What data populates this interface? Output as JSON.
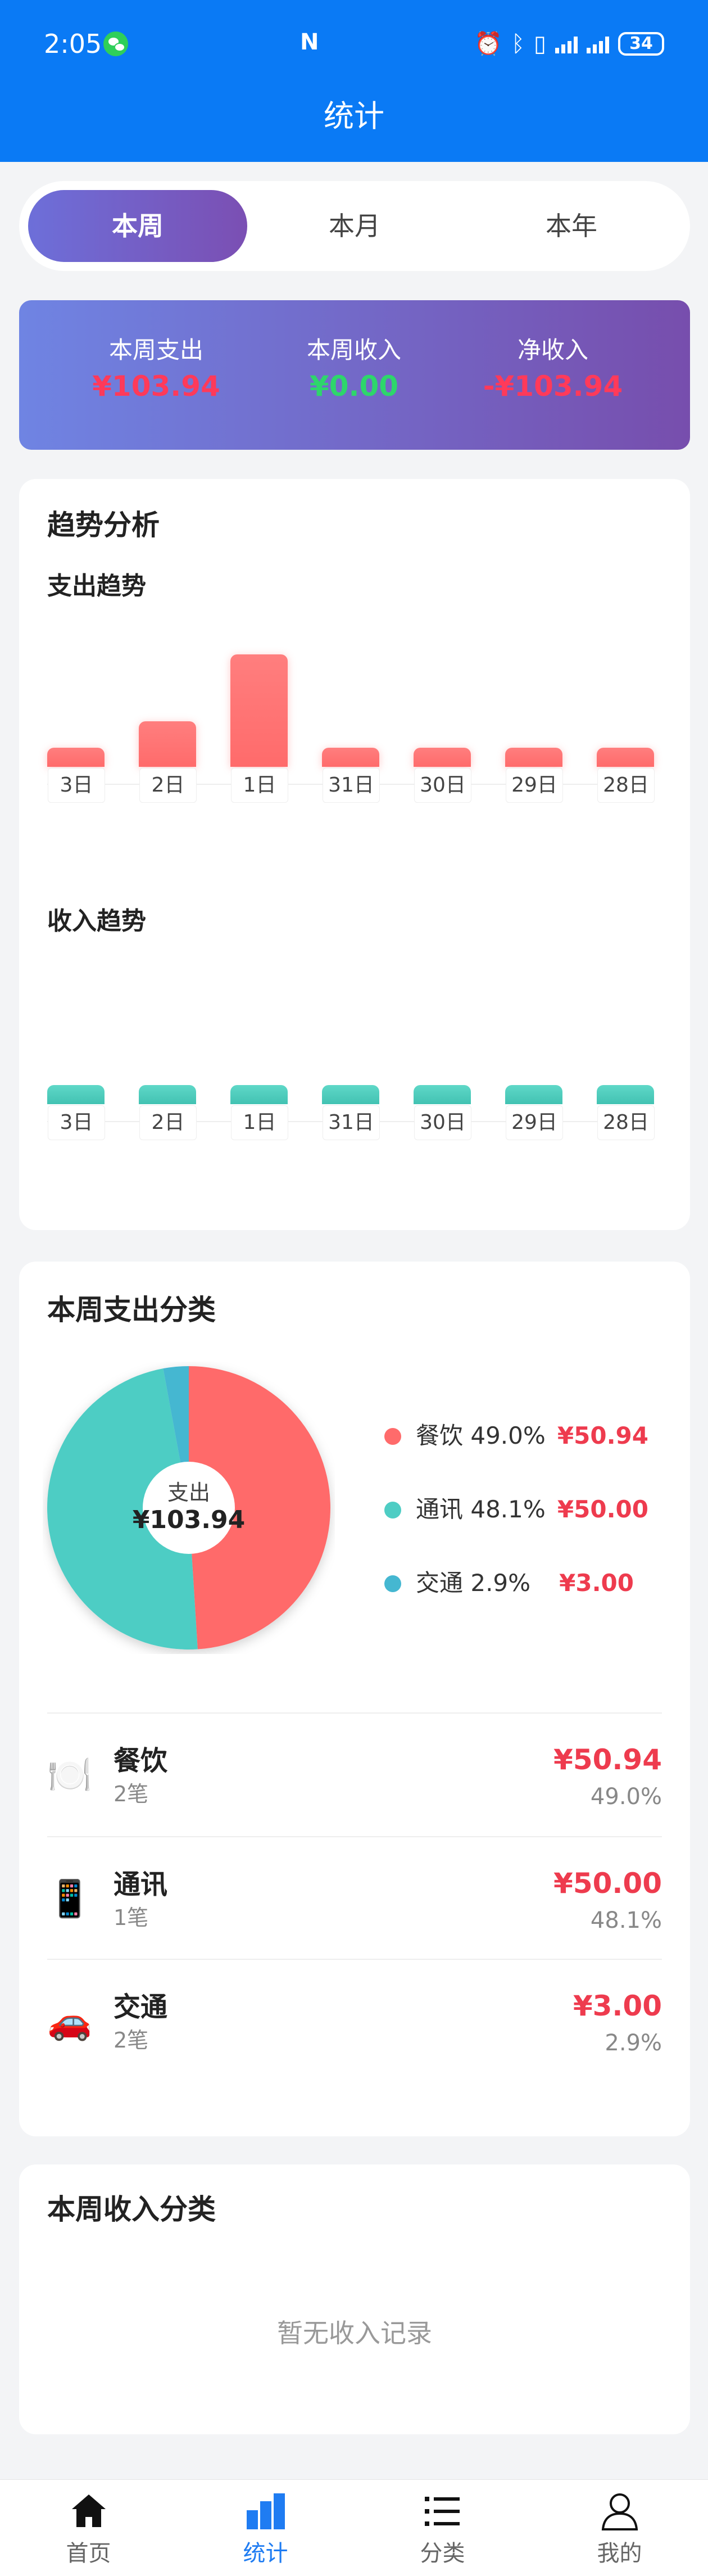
{
  "status_bar": {
    "time": "2:05",
    "battery": "34"
  },
  "header": {
    "title": "统计"
  },
  "period_tabs": [
    {
      "label": "本周",
      "active": true
    },
    {
      "label": "本月",
      "active": false
    },
    {
      "label": "本年",
      "active": false
    }
  ],
  "summary": {
    "expense_label": "本周支出",
    "expense_value": "¥103.94",
    "income_label": "本周收入",
    "income_value": "¥0.00",
    "net_label": "净收入",
    "net_value": "-¥103.94"
  },
  "trend": {
    "title": "趋势分析",
    "expense_title": "支出趋势",
    "income_title": "收入趋势"
  },
  "chart_data": [
    {
      "type": "bar",
      "title": "支出趋势",
      "categories": [
        "3日",
        "2日",
        "1日",
        "31日",
        "30日",
        "29日",
        "28日"
      ],
      "values": [
        0,
        30.0,
        73.94,
        0,
        0,
        0,
        0
      ]
    },
    {
      "type": "bar",
      "title": "收入趋势",
      "categories": [
        "3日",
        "2日",
        "1日",
        "31日",
        "30日",
        "29日",
        "28日"
      ],
      "values": [
        0,
        0,
        0,
        0,
        0,
        0,
        0
      ]
    },
    {
      "type": "pie",
      "title": "本周支出分类",
      "center_label": "支出",
      "center_value": "¥103.94",
      "slices": [
        {
          "name": "餐饮",
          "percent": 49.0,
          "amount": "¥50.94",
          "color": "#ff6b6b"
        },
        {
          "name": "通讯",
          "percent": 48.1,
          "amount": "¥50.00",
          "color": "#4ecdc4"
        },
        {
          "name": "交通",
          "percent": 2.9,
          "amount": "¥3.00",
          "color": "#45b7d1"
        }
      ]
    }
  ],
  "expense_category": {
    "title": "本周支出分类",
    "legend": [
      {
        "label": "餐饮 49.0%",
        "amount": "¥50.94"
      },
      {
        "label": "通讯 48.1%",
        "amount": "¥50.00"
      },
      {
        "label": "交通 2.9%",
        "amount": "¥3.00"
      }
    ],
    "items": [
      {
        "icon": "🍽️",
        "name": "餐饮",
        "count": "2笔",
        "amount": "¥50.94",
        "percent": "49.0%"
      },
      {
        "icon": "📱",
        "name": "通讯",
        "count": "1笔",
        "amount": "¥50.00",
        "percent": "48.1%"
      },
      {
        "icon": "🚗",
        "name": "交通",
        "count": "2笔",
        "amount": "¥3.00",
        "percent": "2.9%"
      }
    ]
  },
  "income_category": {
    "title": "本周收入分类",
    "empty_text": "暂无收入记录"
  },
  "nav": [
    {
      "label": "首页",
      "icon": "home-icon",
      "active": false
    },
    {
      "label": "统计",
      "icon": "chart-icon",
      "active": true
    },
    {
      "label": "分类",
      "icon": "list-icon",
      "active": false
    },
    {
      "label": "我的",
      "icon": "user-icon",
      "active": false
    }
  ],
  "colors": {
    "brand": "#0a7af5",
    "expense": "#ee3b4e",
    "income": "#2ecc71",
    "nav_active": "#1f7cf2"
  }
}
